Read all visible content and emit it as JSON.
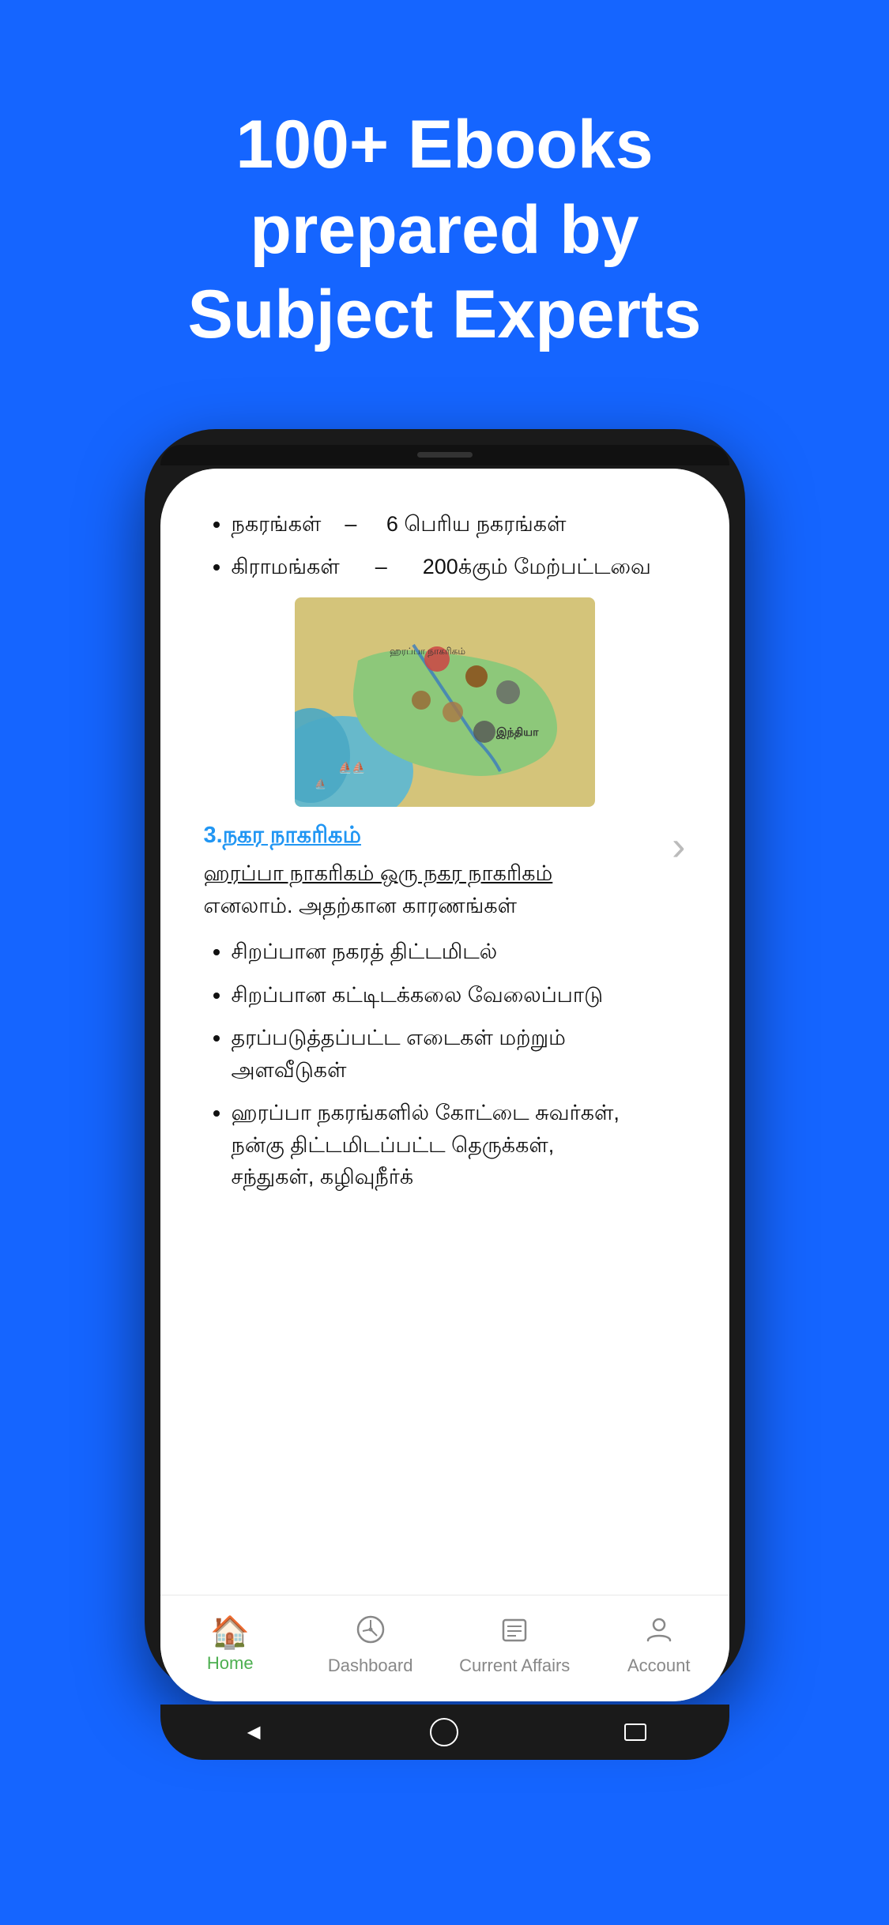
{
  "hero": {
    "line1": "100+ Ebooks",
    "line2": "prepared by",
    "line3": "Subject Experts"
  },
  "phone": {
    "content": {
      "bullet1_prefix": "நகரங்கள்",
      "bullet1_dash": "–",
      "bullet1_value": "6 பெரிய நகரங்கள்",
      "bullet2_prefix": "கிராமங்கள்",
      "bullet2_dash": "–",
      "bullet2_value": "200க்கும் மேற்பட்டவை",
      "map_label": "இந்தியா",
      "section_number": "3.",
      "section_title": "நகர நாகரிகம்",
      "section_subtitle_underline": "ஹரப்பா நாகரிகம் ஒரு நகர நாகரிகம்",
      "section_subtitle_rest": " எனலாம். அதற்கான காரணங்கள்",
      "sub_bullet1": "சிறப்பான நகரத் திட்டமிடல்",
      "sub_bullet2": "சிறப்பான கட்டிடக்கலை வேலைப்பாடு",
      "sub_bullet3": "தரப்படுத்தப்பட்ட எடைகள் மற்றும் அளவீடுகள்",
      "sub_bullet4": "ஹரப்பா நகரங்களில் கோட்டை சுவர்கள், நன்கு திட்டமிடப்பட்ட தெருக்கள், சந்துகள், கழிவுநீர்க்"
    },
    "nav": {
      "home_label": "Home",
      "dashboard_label": "Dashboard",
      "current_affairs_label": "Current Affairs",
      "account_label": "Account"
    }
  }
}
